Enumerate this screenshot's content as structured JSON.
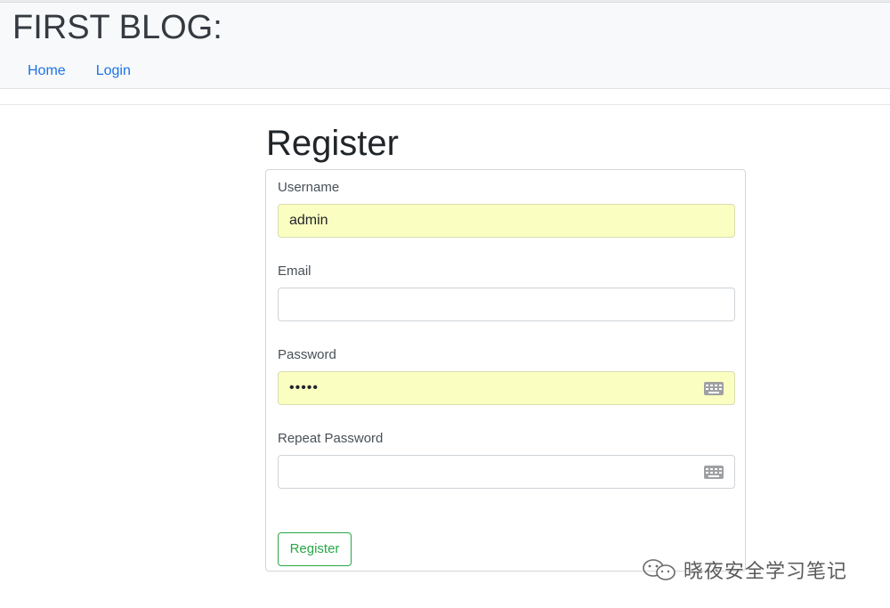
{
  "navbar": {
    "brand": "FIRST BLOG:",
    "links": [
      "Home",
      "Login"
    ]
  },
  "page": {
    "title": "Register"
  },
  "form": {
    "username": {
      "label": "Username",
      "value": "admin"
    },
    "email": {
      "label": "Email",
      "value": ""
    },
    "password": {
      "label": "Password",
      "value": "•••••"
    },
    "repeat_password": {
      "label": "Repeat Password",
      "value": ""
    },
    "submit_label": "Register"
  },
  "watermark": {
    "text": "晓夜安全学习笔记",
    "icon": "wechat-icon"
  },
  "colors": {
    "link": "#1a73e8",
    "autofill": "#fafec0",
    "button": "#28a745"
  }
}
